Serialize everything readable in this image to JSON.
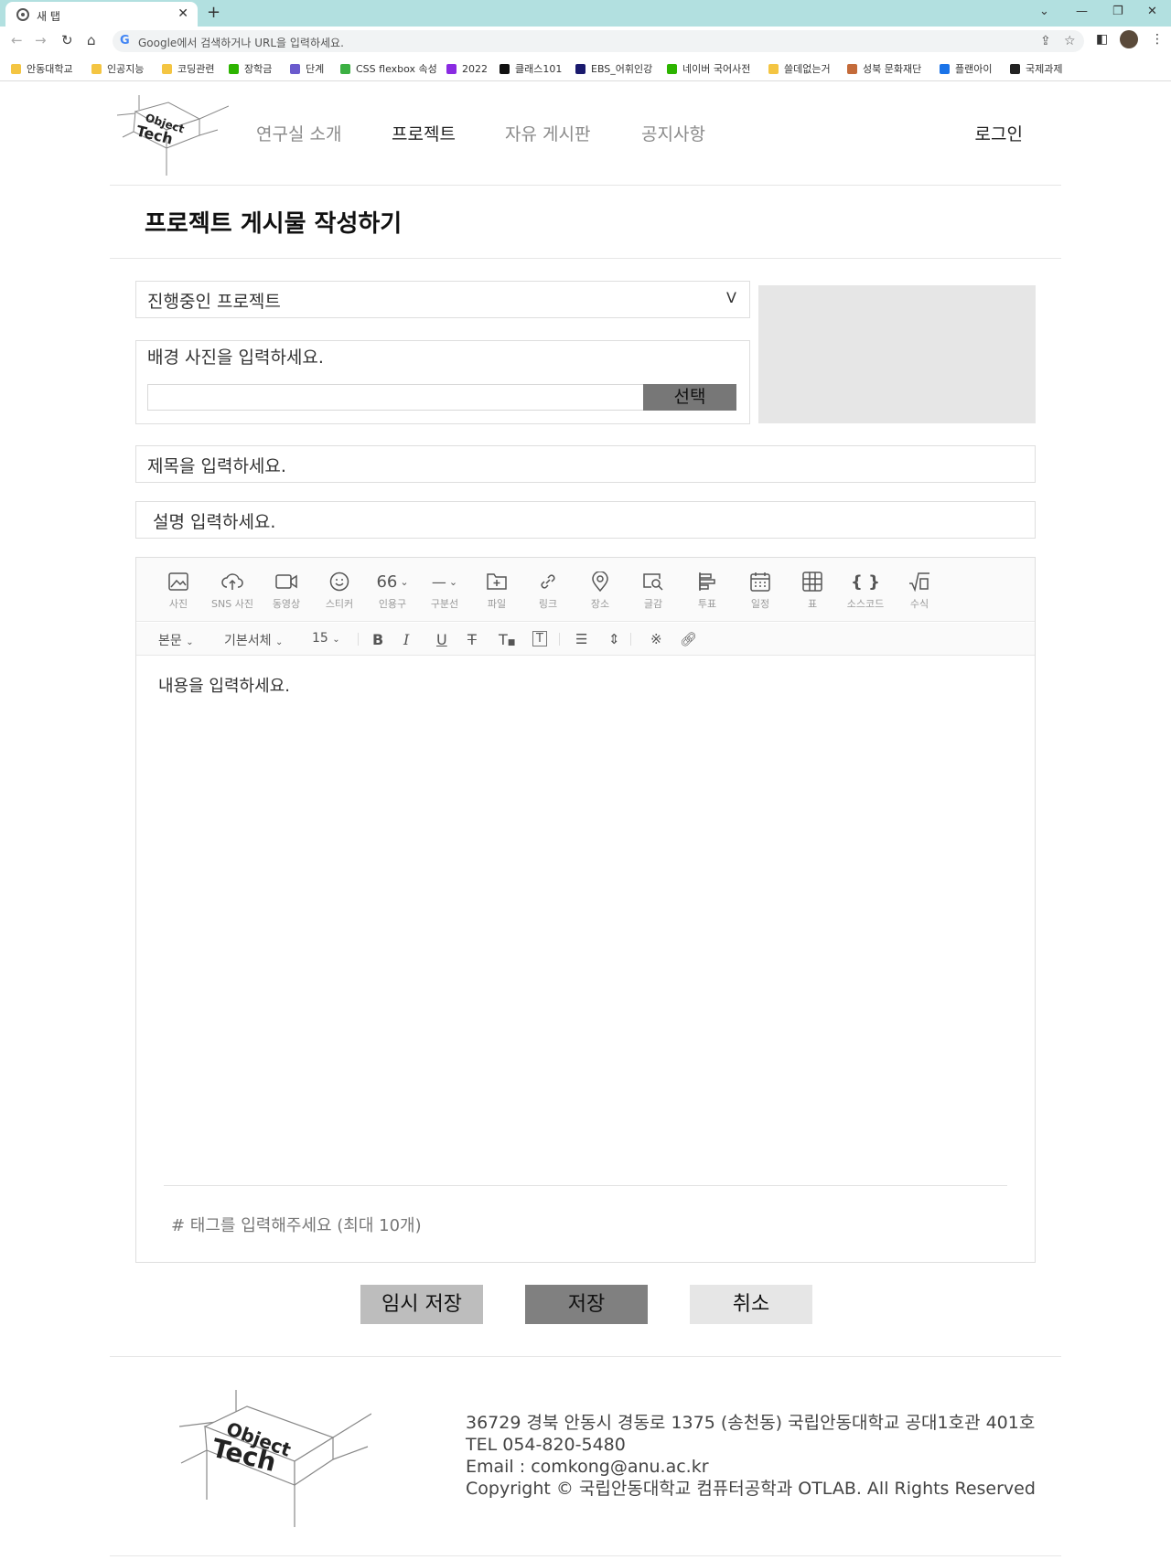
{
  "browser": {
    "tab_title": "새 탭",
    "tab_close": "✕",
    "new_tab": "+",
    "nav_back": "←",
    "nav_forward": "→",
    "nav_reload": "↻",
    "nav_home": "⌂",
    "omnibox_placeholder": "Google에서 검색하거나 URL을 입력하세요.",
    "bookmarks": [
      {
        "label": "안동대학교",
        "color": "#f4c542"
      },
      {
        "label": "인공지능",
        "color": "#f4c542"
      },
      {
        "label": "코딩관련",
        "color": "#f4c542"
      },
      {
        "label": "장학금",
        "color": "#2db400"
      },
      {
        "label": "단계",
        "color": "#6a5acd"
      },
      {
        "label": "CSS flexbox 속성",
        "color": "#3cb043"
      },
      {
        "label": "2022",
        "color": "#8a2be2"
      },
      {
        "label": "클래스101",
        "color": "#111111"
      },
      {
        "label": "EBS_어휘인강",
        "color": "#1a1a6e"
      },
      {
        "label": "네이버 국어사전",
        "color": "#2db400"
      },
      {
        "label": "쓸데없는거",
        "color": "#f4c542"
      },
      {
        "label": "성북 문화재단",
        "color": "#c46b3a"
      },
      {
        "label": "플랜아이",
        "color": "#1a73e8"
      },
      {
        "label": "국제과제",
        "color": "#222222"
      }
    ]
  },
  "header": {
    "logo_line1": "Object",
    "logo_line2": "Tech",
    "nav": [
      "연구실 소개",
      "프로젝트",
      "자유 게시판",
      "공지사항"
    ],
    "active_nav": "프로젝트",
    "login": "로그인"
  },
  "page": {
    "title": "프로젝트 게시물 작성하기"
  },
  "form": {
    "project_select": "진행중인 프로젝트",
    "select_caret": "V",
    "bg_photo_label": "배경 사진을 입력하세요.",
    "bg_photo_button": "선택",
    "title_placeholder": "제목을 입력하세요.",
    "desc_placeholder": "설명 입력하세요."
  },
  "editor": {
    "tools": [
      "사진",
      "SNS 사진",
      "동영상",
      "스티커",
      "인용구",
      "구분선",
      "파일",
      "링크",
      "장소",
      "글감",
      "투표",
      "일정",
      "표",
      "소스코드",
      "수식"
    ],
    "format_style": "본문",
    "format_font": "기본서체",
    "format_size": "15",
    "content_placeholder": "내용을 입력하세요.",
    "tags_placeholder": "# 태그를 입력해주세요 (최대 10개)"
  },
  "buttons": {
    "temp_save": "임시 저장",
    "save": "저장",
    "cancel": "취소"
  },
  "footer": {
    "address": "36729 경북 안동시 경동로 1375 (송천동) 국립안동대학교 공대1호관 401호",
    "tel": "TEL 054-820-5480",
    "email": "Email : comkong@anu.ac.kr",
    "copyright": "Copyright © 국립안동대학교 컴퓨터공학과 OTLAB. All Rights Reserved"
  }
}
